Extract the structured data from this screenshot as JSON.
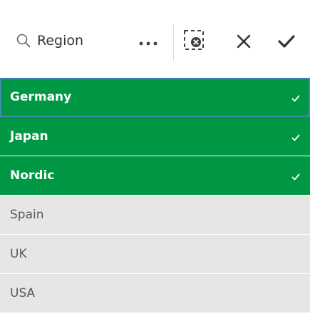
{
  "toolbar": {
    "search_icon": "search-icon",
    "field_name": "Region",
    "more_icon": "more-horizontal-icon",
    "clear_selection_icon": "clear-selection-icon",
    "cancel_icon": "close-icon",
    "confirm_icon": "checkmark-icon"
  },
  "colors": {
    "selected": "#009845",
    "alternative": "#e6e6e6",
    "focus_outline": "#3f8ab3"
  },
  "list": {
    "items": [
      {
        "label": "Germany",
        "state": "selected"
      },
      {
        "label": "Japan",
        "state": "selected"
      },
      {
        "label": "Nordic",
        "state": "selected"
      },
      {
        "label": "Spain",
        "state": "alternative"
      },
      {
        "label": "UK",
        "state": "alternative"
      },
      {
        "label": "USA",
        "state": "alternative"
      }
    ]
  }
}
